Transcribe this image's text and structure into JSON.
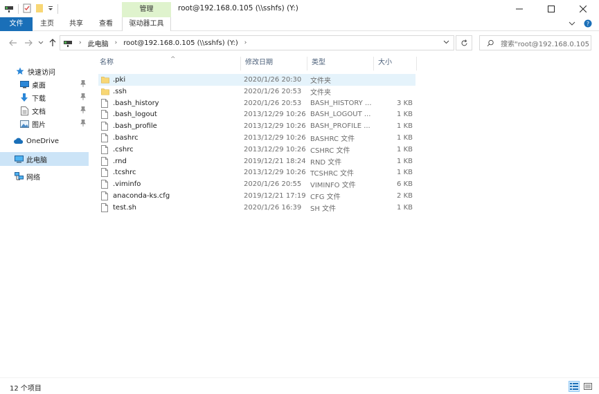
{
  "window": {
    "title": "root@192.168.0.105 (\\\\sshfs) (Y:)",
    "context_tab_group": "管理"
  },
  "ribbon": {
    "tabs": [
      "文件",
      "主页",
      "共享",
      "查看",
      "驱动器工具"
    ]
  },
  "address": {
    "crumbs": [
      "此电脑",
      "root@192.168.0.105 (\\\\sshfs) (Y:)"
    ],
    "search_placeholder": "搜索\"root@192.168.0.105 ..."
  },
  "nav": {
    "quick_access": "快速访问",
    "items": [
      {
        "label": "桌面",
        "icon": "desktop-icon",
        "pinned": true
      },
      {
        "label": "下载",
        "icon": "download-icon",
        "pinned": true
      },
      {
        "label": "文档",
        "icon": "document-icon",
        "pinned": true
      },
      {
        "label": "图片",
        "icon": "picture-icon",
        "pinned": true
      }
    ],
    "onedrive": "OneDrive",
    "this_pc": "此电脑",
    "network": "网络"
  },
  "columns": {
    "name": "名称",
    "date": "修改日期",
    "type": "类型",
    "size": "大小"
  },
  "files": [
    {
      "name": ".pki",
      "date": "2020/1/26 20:30",
      "type": "文件夹",
      "size": "",
      "kind": "folder"
    },
    {
      "name": ".ssh",
      "date": "2020/1/26 20:53",
      "type": "文件夹",
      "size": "",
      "kind": "folder"
    },
    {
      "name": ".bash_history",
      "date": "2020/1/26 20:53",
      "type": "BASH_HISTORY ...",
      "size": "3 KB",
      "kind": "file"
    },
    {
      "name": ".bash_logout",
      "date": "2013/12/29 10:26",
      "type": "BASH_LOGOUT ...",
      "size": "1 KB",
      "kind": "file"
    },
    {
      "name": ".bash_profile",
      "date": "2013/12/29 10:26",
      "type": "BASH_PROFILE ...",
      "size": "1 KB",
      "kind": "file"
    },
    {
      "name": ".bashrc",
      "date": "2013/12/29 10:26",
      "type": "BASHRC 文件",
      "size": "1 KB",
      "kind": "file"
    },
    {
      "name": ".cshrc",
      "date": "2013/12/29 10:26",
      "type": "CSHRC 文件",
      "size": "1 KB",
      "kind": "file"
    },
    {
      "name": ".rnd",
      "date": "2019/12/21 18:24",
      "type": "RND 文件",
      "size": "1 KB",
      "kind": "file"
    },
    {
      "name": ".tcshrc",
      "date": "2013/12/29 10:26",
      "type": "TCSHRC 文件",
      "size": "1 KB",
      "kind": "file"
    },
    {
      "name": ".viminfo",
      "date": "2020/1/26 20:55",
      "type": "VIMINFO 文件",
      "size": "6 KB",
      "kind": "file"
    },
    {
      "name": "anaconda-ks.cfg",
      "date": "2019/12/21 17:19",
      "type": "CFG 文件",
      "size": "2 KB",
      "kind": "file"
    },
    {
      "name": "test.sh",
      "date": "2020/1/26 16:39",
      "type": "SH 文件",
      "size": "1 KB",
      "kind": "file"
    }
  ],
  "status": {
    "item_count": "12 个项目"
  },
  "colors": {
    "accent": "#1a6fb8",
    "context_tab": "#dff3cd",
    "selection": "#cce4f7",
    "folder": "#f8d775"
  }
}
